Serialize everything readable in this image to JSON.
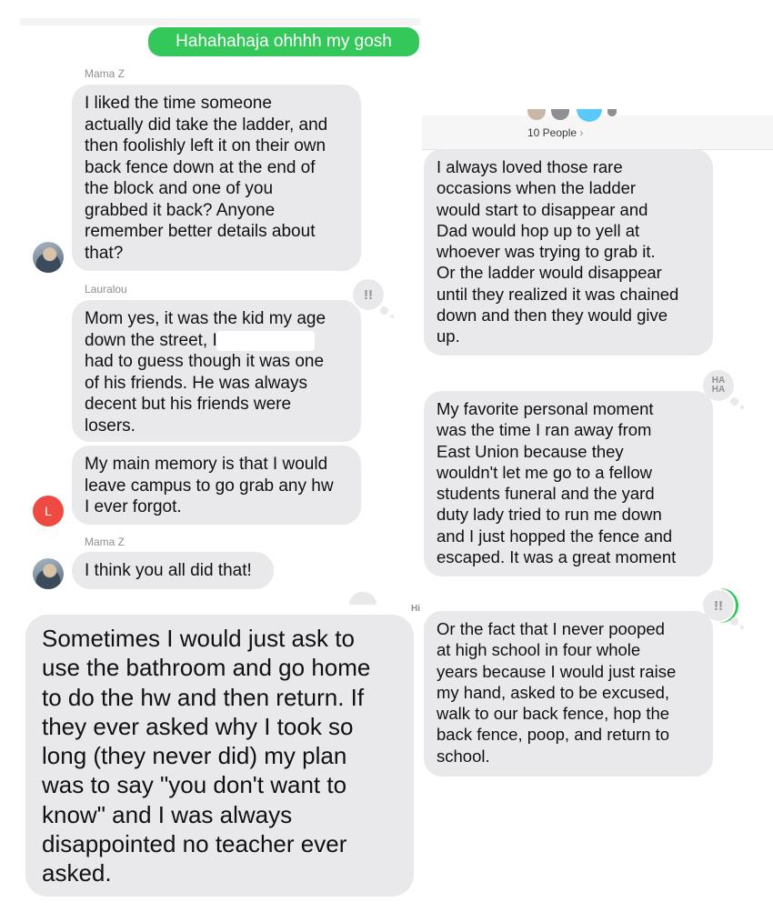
{
  "left_thread": {
    "sent_message": "Hahahahaja ohhhh my gosh",
    "messages": [
      {
        "sender": "Mama Z",
        "text": "I liked the time someone\nactually did take the ladder, and\nthen foolishly left it on their own\nback fence down at the end of\nthe block and one of you\ngrabbed it back? Anyone\nremember better details about\nthat?"
      },
      {
        "sender": "Lauralou",
        "text": "Mom yes, it was the kid my age\ndown the street,                     If I\nhad to guess though it was one\nof his friends. He was always\ndecent but his friends were\nlosers."
      },
      {
        "text": "My main memory is that I would\nleave campus to go grab any hw\nI ever forgot."
      },
      {
        "sender": "Mama Z",
        "text": "I think you all did that!"
      }
    ],
    "avatar_initial": "L",
    "tapback_emphasis": "!!",
    "large_message": "Sometimes I would just ask to\nuse the bathroom and go home\nto do the hw and then return. If\nthey ever asked why I took so\nlong (they never did) my plan\nwas to say \"you don't want to\nknow\" and I was always\ndisappointed no teacher ever\nasked."
  },
  "right_thread": {
    "group_label": "10 People",
    "messages": [
      {
        "text": "I always loved those rare\noccasions when the ladder\nwould start to disappear and\nDad would hop up to yell at\nwhoever was trying to grab it.\nOr the ladder would disappear\nuntil they realized it was chained\ndown and then they would give\nup."
      },
      {
        "text": "My favorite personal moment\nwas the time I ran away from\nEast Union because they\nwouldn't let me go to a fellow\nstudents funeral and the yard\nduty lady tried to run me down\nand I just hopped the fence and\nescaped. It was a great moment"
      },
      {
        "text": "Or the fact that I never pooped\nat high school in four whole\nyears because I would just raise\nmy hand, asked to be excused,\nwalk to our back fence, hop the\nback fence, poop, and return to\nschool."
      }
    ],
    "tapback_haha": "HA\nHA",
    "tapback_emphasis": "!!"
  },
  "colors": {
    "bubble_gray": "#e9e9eb",
    "sent_green": "#34c759",
    "avatar_red": "#ef4a42"
  }
}
